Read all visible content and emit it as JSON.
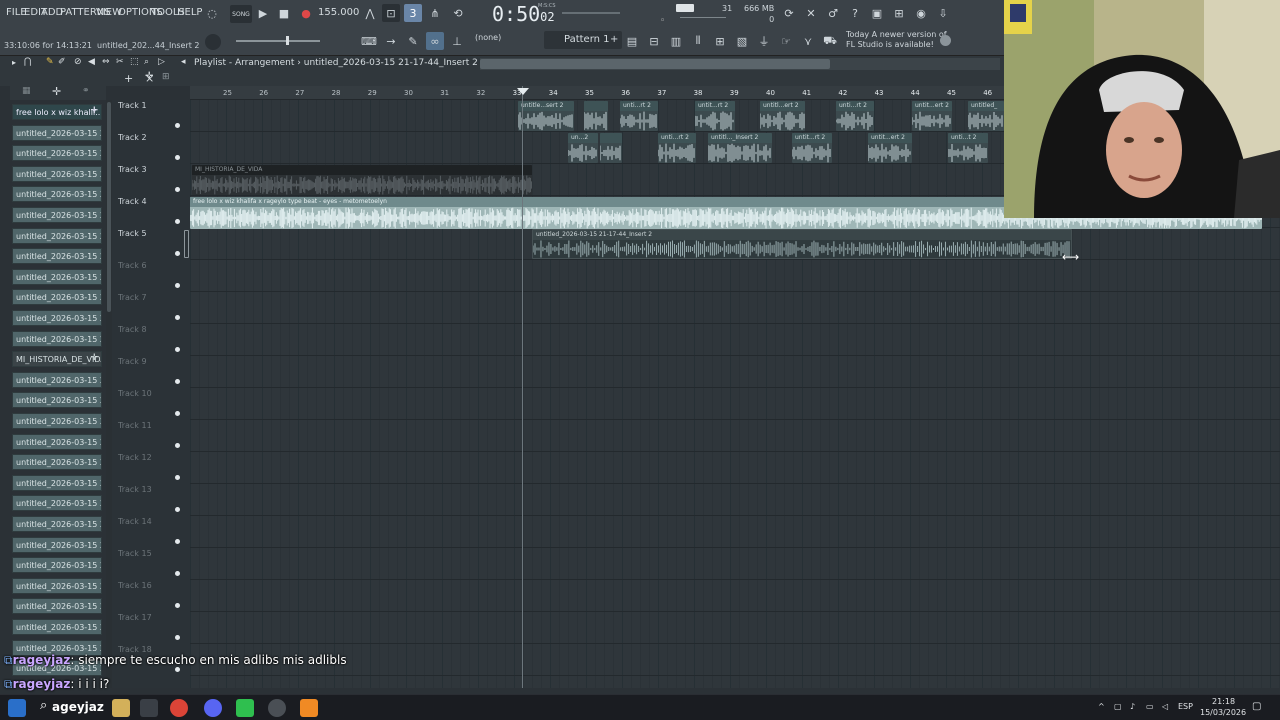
{
  "menu": [
    "FILE",
    "EDIT",
    "ADD",
    "PATTERNS",
    "VIEW",
    "OPTIONS",
    "TOOLS",
    "HELP"
  ],
  "transport": {
    "mode_label": "SONG",
    "tempo": "155.000",
    "time_main": "0:50",
    "time_sub": "02",
    "time_unit": "M:S:CS",
    "memory": "666 MB",
    "cpu": "31",
    "voices": "0"
  },
  "status": {
    "time": "33:10:06 for 14:13:21",
    "file": "untitled_202...44_Insert 2"
  },
  "pattern": {
    "selector": "(none)",
    "current": "Pattern 1"
  },
  "news": {
    "line1": "Today  A newer version of",
    "line2": "FL Studio is available!"
  },
  "playlist": {
    "title": "Playlist - Arrangement",
    "breadcrumb": "untitled_2026-03-15 21-17-44_Insert 2",
    "sep": "›"
  },
  "ruler": [
    "25",
    "26",
    "27",
    "28",
    "29",
    "30",
    "31",
    "32",
    "33",
    "34",
    "35",
    "36",
    "37",
    "38",
    "39",
    "40",
    "41",
    "42",
    "43",
    "44",
    "45",
    "46"
  ],
  "picker": [
    {
      "label": "free lolo x wiz khalif...",
      "state": "sel"
    },
    {
      "label": "untitled_2026-03-15 20-...",
      "state": ""
    },
    {
      "label": "untitled_2026-03-15 20-...",
      "state": ""
    },
    {
      "label": "untitled_2026-03-15 20-...",
      "state": ""
    },
    {
      "label": "untitled_2026-03-15 20-...",
      "state": ""
    },
    {
      "label": "untitled_2026-03-15 20-...",
      "state": ""
    },
    {
      "label": "untitled_2026-03-15 20-...",
      "state": ""
    },
    {
      "label": "untitled_2026-03-15 20-...",
      "state": ""
    },
    {
      "label": "untitled_2026-03-15 20-...",
      "state": ""
    },
    {
      "label": "untitled_2026-03-15 20-...",
      "state": ""
    },
    {
      "label": "untitled_2026-03-15 20-...",
      "state": ""
    },
    {
      "label": "untitled_2026-03-15 20-...",
      "state": ""
    },
    {
      "label": "MI_HISTORIA_DE_VIDA",
      "state": "dark"
    },
    {
      "label": "untitled_2026-03-15 20-...",
      "state": ""
    },
    {
      "label": "untitled_2026-03-15 20-...",
      "state": ""
    },
    {
      "label": "untitled_2026-03-15 20-...",
      "state": ""
    },
    {
      "label": "untitled_2026-03-15 20-...",
      "state": ""
    },
    {
      "label": "untitled_2026-03-15 20-...",
      "state": ""
    },
    {
      "label": "untitled_2026-03-15 20-...",
      "state": ""
    },
    {
      "label": "untitled_2026-03-15 20-...",
      "state": ""
    },
    {
      "label": "untitled_2026-03-15 20-...",
      "state": ""
    },
    {
      "label": "untitled_2026-03-15 20-...",
      "state": ""
    },
    {
      "label": "untitled_2026-03-15 20-...",
      "state": ""
    },
    {
      "label": "untitled_2026-03-15 20-...",
      "state": ""
    },
    {
      "label": "untitled_2026-03-15 20-...",
      "state": ""
    },
    {
      "label": "untitled_2026-03-15 20-...",
      "state": ""
    },
    {
      "label": "untitled_2026-03-15 20-...",
      "state": ""
    },
    {
      "label": "untitled_2026-03-15 20-...",
      "state": ""
    }
  ],
  "tracks": [
    "Track 1",
    "Track 2",
    "Track 3",
    "Track 4",
    "Track 5",
    "Track 6",
    "Track 7",
    "Track 8",
    "Track 9",
    "Track 10",
    "Track 11",
    "Track 12",
    "Track 13",
    "Track 14",
    "Track 15",
    "Track 16",
    "Track 17",
    "Track 18"
  ],
  "clips": {
    "t1": [
      "untitle...sert 2",
      "",
      "unti...rt 2",
      "untit...rt 2",
      "untitl...ert 2",
      "unti...rt 2",
      "untit...ert 2",
      "untitled_"
    ],
    "t2": [
      "un...2",
      "",
      "unti...rt 2",
      "untitl..._Insert 2",
      "untit...rt 2",
      "untit...ert 2",
      "unti...t 2"
    ],
    "t3": "MI_HISTORIA_DE_VIDA",
    "t4": "free lolo x wiz khalifa x rageylo type beat - eyes - metometoelyn",
    "t5": "untitled_2026-03-15 21-17-44_Insert 2"
  },
  "chat": [
    {
      "user": "rageyjaz",
      "text": ": siempre te escucho en mis adlibs mis adlibls"
    },
    {
      "user": "rageyjaz",
      "text": ": i i i i?"
    }
  ],
  "taskbar": {
    "search_label": "ageyjaz",
    "lang": "ESP",
    "clock_time": "21:18",
    "clock_date": "15/03/2026"
  }
}
